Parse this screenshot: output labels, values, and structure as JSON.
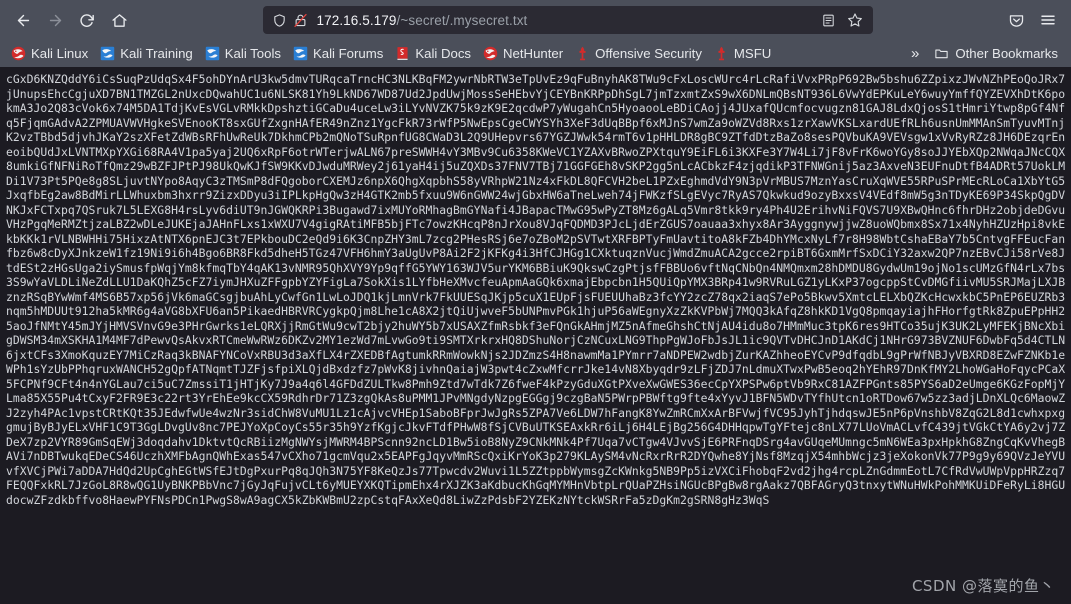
{
  "browser": {
    "nav": {
      "back_label": "Back",
      "forward_label": "Forward",
      "reload_label": "Reload",
      "home_label": "Home"
    },
    "urlbar": {
      "shield_label": "Tracking protection",
      "lock_label": "Connection is not secure",
      "host": "172.16.5.179",
      "path": "/~secret/.mysecret.txt",
      "full_url": "172.16.5.179/~secret/.mysecret.txt",
      "reader_label": "Reader view",
      "bookmark_label": "Bookmark this page"
    },
    "tail": {
      "pocket_label": "Save to Pocket",
      "menu_label": "Open application menu"
    },
    "bookmarks": [
      {
        "label": "Kali Linux",
        "icon": "kali-dragon-red-icon"
      },
      {
        "label": "Kali Training",
        "icon": "kali-dragon-blue-icon"
      },
      {
        "label": "Kali Tools",
        "icon": "kali-dragon-blue-icon"
      },
      {
        "label": "Kali Forums",
        "icon": "kali-dragon-blue-icon"
      },
      {
        "label": "Kali Docs",
        "icon": "red-book-icon"
      },
      {
        "label": "NetHunter",
        "icon": "kali-dragon-red-icon"
      },
      {
        "label": "Offensive Security",
        "icon": "red-torch-icon"
      },
      {
        "label": "MSFU",
        "icon": "red-torch-icon"
      }
    ],
    "overflow_label": "»",
    "other_bookmarks_label": "Other Bookmarks",
    "folder_icon": "folder-icon"
  },
  "colors": {
    "chrome_bg": "#4b4f5a",
    "urlbar_bg": "#2b2a33",
    "page_bg": "#1c1b22",
    "page_text": "#d2d5da",
    "accent_red": "#d32b2b",
    "accent_blue": "#2a7fd4"
  },
  "page": {
    "body_text": "cGxD6KNZQddY6iCsSuqPzUdqSx4F5ohDYnArU3kw5dmvTURqcaTrncHC3NLKBqFM2ywrNbRTW3eTpUvEz9qFuBnyhAK8TWu9cFxLoscWUrc4rLcRafiVvxPRpP692Bw5bshu6ZZpixzJWvNZhPEoQoJRx7jUnupsEhcCgjuXD7BN1TMZGL2nUxcDQwahUC1u6NLSK81Yh9LkND67WD87Ud2JpdUwjMossSeHEbvYjCEYBnKRPpDhSgL7jmTzxmtZxS9wX6DNLmQBsNT936L6VwYdEPKuLeY6wuyYmffQYZEVXhDtK6pokmA3Jo2Q83cVok6x74M5DA1TdjKvEsVGLvRMkkDpshztiGCaDu4uceLw3iLYvNVZK75k9zK9E2qcdwP7yWugahCn5HyoaooLeBDiCAojj4JUxafQUcmfocvugzn81GAJ8LdxQjosS1tHmriYtwp8pGf4Nfq5FjqmGAdvA2ZPMUAVWVHgkeSVEnooKT8sxGUfZxgnHAfER49nZnz1YgcFkR73rWfP5NwEpsCgeCWYSYh3XeF3dUqBBpf6xMJnS7wmZa9oWZVd8Rxs1zrXawVKSLxardUEfRLh6usnUmMMAnSmTyuvMTnjK2vzTBbd5djvhJKaY2szXFetZdWBsRFhUwReUk7DkhmCPb2mQNoTSuRpnfUG8CWaD3L2Q9UHepvrs67YGZJWwk54rmT6v1pHHLDR8gBC9ZTfdDtzBaZo8sesPQVbuKA9VEVsgw1xVvRyRZz8JH6DEzqrEneoibQUdJxLVNTMXpYXGi68RA4V1pa5yaj2UQ6xRpF6otrWTerjwALN67preSWWH4vY3MBv9Cu6358KWeVC1YZAXvBRwoZPXtquY9EiFL6i3KXFe3Y7W4Li7jF8vFrK6woYGy8soJJYEbXQp2NWqaJNcCQX8umkiGfNFNiRoTfQmz29wBZFJPtPJ98UkQwKJfSW9KKvDJwduMRWey2j61yaH4ij5uZQXDs37FNV7TBj71GGFGEh8vSKP2gg5nLcACbkzF4zjqdikP3TFNWGnij5az3AxveN3EUFnuDtfB4ADRt57UokLMDi1V73Pt5PQe8g8SLjuvtNYpo8AqyC3zTMSmP8dFQgoborCXEMJz6npX6QhgXqpbhS58yVRhpW21Nz4xFkDL8QFCVH2beL1PZxEghmdVdY9N3pVrMBUS7MznYasCruXqWVE55RPuSPrMEcRLoCa1XbYtG5JxqfbEg2aw8BdMirLLWhuxbm3hxrr9ZizxDDyu3iIPLkpHgQw3zH4GTK2mb5fxuu9W6nGWW24wjGbxHW6aTneLweh74jFWKzfSLgEVyc7RyAS7Qkwkud9ozyBxxsV4VEdf8mW5g3nTDyKE69P34SkpQgDVNKJxFCTxpq7QSruk7L5LEXG8H4rsLyv6diUT9nJGWQKRPi3Bugawd7ixMUYoRMhagBmGYNafi4JBapacTMwG95wPyZT8Mz6gALq5Vmr8tkk9ry4Ph4U2ErihvNiFQVS7U9XBwQHnc6fhrDHz2objdeDGvuVHzPgqMeRMZtjzaLBZ2wDLeJUKEjaJAHnFLxs1xWXU7V4gigRAtiMFB5bjFTc7owzKHcqP8nJrXou8VJqFQDMD3PJcLjdErZGUS7oauaa3xhyx8Ar3AyggnywjjwZ8uoWQbmx8Sx71x4NyhHZUzHpi8vkEkbKKk1rVLNBWHHi75HixzAtNTX6pnEJC3t7EPkbouDC2eQd9i6K3CnpZHY3mL7zcg2PHesRSj6e7oZBoM2pSVTwtXRFBPTyFmUavtitoA8kFZb4DhYMcxNyLf7r8H98WbtCshaEBaY7b5CntvgFFEucFanfbz6w8cDyXJnkzeW1fz19Ni9i6h4Bgo6BR8Fkd5dheH5TGz47VFH6hmY3aUgUvP8Ai2F2jKFKg4i3HfCJHGg1CXktuqznVucjWmdZmuACA2gcce2rpiBT6GxmMrfSxDCiY32axw2QP7nzEBvCJi58rVe8JtdESt2zHGsUga2iySmusfpWqjYm8kfmqTbY4qAK13vNMR95QhXVY9Yp9qffG5YWY163WJV5urYKM6BBiuK9QkswCzgPtjsfFBBUo6vftNqCNbQn4NMQmxm28hDMDU8GydwUm19ojNo1scUMzGfN4rLx7bs3S9wYaVLDLiNeZdLLU1DaKQhZ5cFZ7iymJHXuZFFgpbYZYFigLa7SokXis1LYfbHeXMvcfeuApmAaGQk6xmajEbpcbn1H5QUiQpYMX3BRp41w9RVRuLGZ1yLKxP37ogcppStCvDMGfiivMU5SRJMajLXJBznzRSqBYwWmf4MS6B57xp56jVk6maGCsgjbuAhLyCwfGn1LwLoJDQ1kjLmnVrk7FkUUESqJKjp5cuX1EUpFjsFUEUUhaBz3fcYY2zcZ78qx2iaqS7ePo5Bkwv5XmtcLELXbQZKcHcwxkbC5PnEP6EUZRb3nqm5hMDUUt912ha5kMR6g4aVG8bXFU6an5PikaedHBRVRCygkpQjm8Lhe1cA8X2jtQiUjwveF5bUNPmvPGk1hjuP56aWEgnyXzZkKVPbWj7MQQ3kAfqZ8hkKD1VgQ8pmqayiajhFHorfgtRk8ZpuEPpHH25aoJfNMtY45mJYjHMVSVnvG9e3PHrGwrks1eLQRXjjRmGtWu9cwT2bjy2huWY5b7xUSAXZfmRsbkf3eFQnGkAHmjMZ5nAfmeGhshCtNjAU4idu8o7HMmMuc3tpK6res9HTCo35ujK3UK2LyMFEKjBNcXbigDWSM34mXSKHA1M4MF7dPewvQsAkvxRTCmeWwRWz6DKZv2MY1ezWd7mLvwGo9ti9SMTXrkrxHQ8DShuNorjCzNCuxLNG9ThpPgWJoFbJsJL1ic9QVTvDHCJnD1AKdCj1NHrG973BVZNUF6DwbFq5d4CTLN6jxtCFs3XmoKquzEY7MiCzRaq3kBNAFYNCoVxRBU3d3aXfLX4rZXEDBfAgtumkRRmWowkNjs2JDZmzS4H8nawmMa1PYmrr7aNDPEW2wdbjZurKAZhheoEYCvP9dfqdbL9gPrWfNBJyVBXRD8EZwFZNKb1eWPh1sYzUbPPhqruxWANCH52gQpfATNqmtTJZFjsfpiXLQjdBxdzfz7pWvK8jivhnQaiajW3pwt4cZxwMfcrrJke14vN8Xbyqdr9zLFjZDJ7nLdmuXTwxPwB5eoq2hYEhR97DnKfMY2LhoWGaHoFqycPCaX5FCPNf9CFt4n4nYGLau7ci5uC7ZmssiT1jHTjKy7J9a4q6l4GFDdZULTkw8Pmh9Ztd7wTdk7Z6fweF4kPzyGduXGtPXveXwGWES36ecCpYXPSPw6ptVb9RxC81AZFPGnts85PYS6aD2eUmge6KGzFopMjYLma85X55Pu4tCxyF2FR9E3c22rt3YrEhEe9kcCX59RdhrDr71Z3zgQkAs8uPMM1JPvMNgdyNzpgEGGgj9czgBaN5PWrpPBWftg9fte4xYyvJ1BFN5WDvTYfhUtcn1oRTDow67w5zz3adjLDnXLQc6MaowZJ2zyh4PAc1vpstCRtKQt35JEdwfwUe4wzNr3sidChW8VuMU1Lz1cAjvcVHEp1SaboBFprJwJgRs5ZPA7Ve6LDW7hFangK8YwZmRCmXxArBFVwjfVC95JyhTjhdqswJE5nP6pVnshbV8ZqG2L8d1cwhxpxggmujByBJyELxVHF1C9T3GgLDvgUv8nc7PEJYoXpCoyCs55r35h9YzfKgjcJkvFTdfPHwW8fSjCVBuUTKSEAxkRr6iLj6H4LEjBg256G4DHHqpwTgYFtejc8nLX77LUoVmACLvfC439jtVGkCtYA6y2vj7ZDeX7zp2VYR89GmSqEWj3doqdahv1DktvtQcRBiizMgNWYsjMWRM4BPScnn92ncLD1Bw5ioB8NyZ9CNkMNk4Pf7Uqa7vCTgw4VJvvSjE6PRFnqDSrg4avGUqeMUmngc5mN6WEa3pxHpkhG8ZngCqKvVhegBAVi7nDBTwukqEDeCS46UczhXMFbAgnQWhExas547vCXho71gcmVqu2x5EAPFgJqyvMmRScQxiKrYoK3p279KLAySM4vNcRxrRrR2DYQwhe8YjNsf8MzqjX54mhbWcjz3jeXokonVk77P9g9y69QVzJeYVUvfXVCjPWi7aDDA7HdQd2UpCghEGtWSfEJtDgPxurPq8qJQh3N75YF8KeQzJs77Tpwcdv2Wuvi1L5ZZtppbWymsgZcKWnkg5NB9Pp5izVXCiFhobqF2vd2jhg4rcpLZnGdmmEotL7CfRdVwUWpVppHRZzq7FEQQFxkRL7JzGoL8R8wQG1UyBNKPBbVnc7jGyJqFujvCLt6yMUEYXKQTipmEhx4rXJZK3aKdbucKhGqMYMHnVbtpLrQUaPZHsiNGUcBPgBw8rgAakz7QBFAGryQ3tnxytWNuHWkPohMMKUiDFeRyLi8HGUdocwZFzdkbffvo8HaewPYFNsPDCn1PwgS8wA9agCX5kZbKWBmU2zpCstqFAxXeQd8LiwZzPdsbF2YZEKzNYtckWSRrFa5zDgKm2gSRN8gHz3WqS",
    "watermark": "CSDN @落寞的鱼丶"
  }
}
